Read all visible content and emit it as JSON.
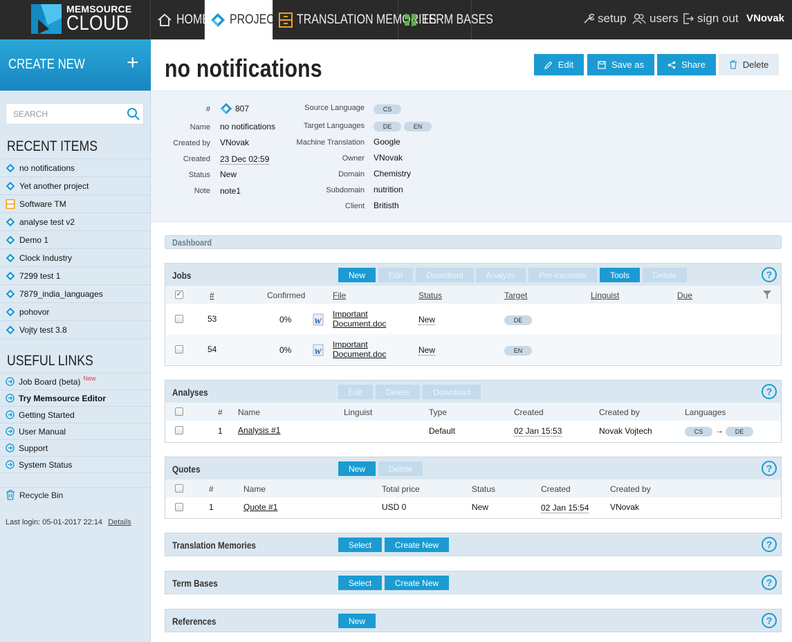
{
  "brand": {
    "line1": "MEMSOURCE",
    "line2": "CLOUD"
  },
  "nav": {
    "home": "HOME",
    "projects": "PROJECTS",
    "tm": "TRANSLATION MEMORIES",
    "tb": "TERM BASES"
  },
  "toplinks": {
    "setup": "setup",
    "users": "users",
    "signout": "sign out",
    "user": "VNovak"
  },
  "sidebar": {
    "create_new": "CREATE NEW",
    "search_placeholder": "SEARCH",
    "recent_heading": "RECENT ITEMS",
    "recent": [
      {
        "label": "no notifications",
        "icon": "project-icon"
      },
      {
        "label": "Yet another project",
        "icon": "project-icon"
      },
      {
        "label": "Software TM",
        "icon": "tm-icon"
      },
      {
        "label": "analyse test v2",
        "icon": "project-icon"
      },
      {
        "label": "Demo 1",
        "icon": "project-icon"
      },
      {
        "label": "Clock Industry",
        "icon": "project-icon"
      },
      {
        "label": "7299 test 1",
        "icon": "project-icon"
      },
      {
        "label": "7879_india_languages",
        "icon": "project-icon"
      },
      {
        "label": "pohovor",
        "icon": "project-icon"
      },
      {
        "label": "Vojty test 3.8",
        "icon": "project-icon"
      }
    ],
    "links_heading": "USEFUL LINKS",
    "links": [
      {
        "label": "Job Board (beta)",
        "badge": "New"
      },
      {
        "label": "Try Memsource Editor",
        "bold": true
      },
      {
        "label": "Getting Started"
      },
      {
        "label": "User Manual"
      },
      {
        "label": "Support"
      },
      {
        "label": "System Status"
      }
    ],
    "recycle": "Recycle Bin",
    "last_login": "Last login: 05-01-2017 22:14",
    "details": "Details"
  },
  "header": {
    "title": "no notifications",
    "edit": "Edit",
    "save_as": "Save as",
    "share": "Share",
    "delete": "Delete"
  },
  "info": {
    "id_label": "#",
    "id": "807",
    "name_label": "Name",
    "name": "no notifications",
    "created_by_label": "Created by",
    "created_by": "VNovak",
    "created_label": "Created",
    "created": "23 Dec 02:59",
    "status_label": "Status",
    "status": "New",
    "note_label": "Note",
    "note": "note1",
    "source_label": "Source Language",
    "source": "CS",
    "target_label": "Target Languages",
    "targets": [
      "DE",
      "EN"
    ],
    "mt_label": "Machine Translation",
    "mt": "Google",
    "owner_label": "Owner",
    "owner": "VNovak",
    "domain_label": "Domain",
    "domain": "Chemistry",
    "subdomain_label": "Subdomain",
    "subdomain": "nutrition",
    "client_label": "Client",
    "client": "Britisth"
  },
  "dashboard": "Dashboard",
  "jobs": {
    "title": "Jobs",
    "buttons": [
      "New",
      "Edit",
      "Download",
      "Analyze",
      "Pre-translate",
      "Tools",
      "Delete"
    ],
    "cols": {
      "num": "#",
      "confirmed": "Confirmed",
      "file": "File",
      "status": "Status",
      "target": "Target",
      "linguist": "Linguist",
      "due": "Due"
    },
    "rows": [
      {
        "num": "53",
        "confirmed": "0%",
        "file1": "Important",
        "file2": "Document.doc",
        "status": "New",
        "target": "DE"
      },
      {
        "num": "54",
        "confirmed": "0%",
        "file1": "Important",
        "file2": "Document.doc",
        "status": "New",
        "target": "EN"
      }
    ]
  },
  "analyses": {
    "title": "Analyses",
    "buttons": [
      "Edit",
      "Delete",
      "Download"
    ],
    "cols": {
      "num": "#",
      "name": "Name",
      "linguist": "Linguist",
      "type": "Type",
      "created": "Created",
      "created_by": "Created by",
      "languages": "Languages"
    },
    "rows": [
      {
        "num": "1",
        "name": "Analysis #1",
        "type": "Default",
        "created": "02 Jan 15:53",
        "created_by": "Novak Vojtech",
        "src": "CS",
        "arrow": "→",
        "tgt": "DE"
      }
    ]
  },
  "quotes": {
    "title": "Quotes",
    "buttons": [
      "New",
      "Delete"
    ],
    "cols": {
      "num": "#",
      "name": "Name",
      "price": "Total price",
      "status": "Status",
      "created": "Created",
      "created_by": "Created by"
    },
    "rows": [
      {
        "num": "1",
        "name": "Quote #1",
        "price": "USD 0",
        "status": "New",
        "created": "02 Jan 15:54",
        "created_by": "VNovak"
      }
    ]
  },
  "tms": {
    "title": "Translation Memories",
    "select": "Select",
    "create": "Create New"
  },
  "tbs": {
    "title": "Term Bases",
    "select": "Select",
    "create": "Create New"
  },
  "refs": {
    "title": "References",
    "new": "New"
  },
  "help": "?",
  "colors": {
    "accent": "#1b9bd2",
    "topbar": "#2a2a2a",
    "sidebar": "#dde9f2",
    "tm_orange": "#f0a020",
    "tb_green": "#5bb548"
  }
}
